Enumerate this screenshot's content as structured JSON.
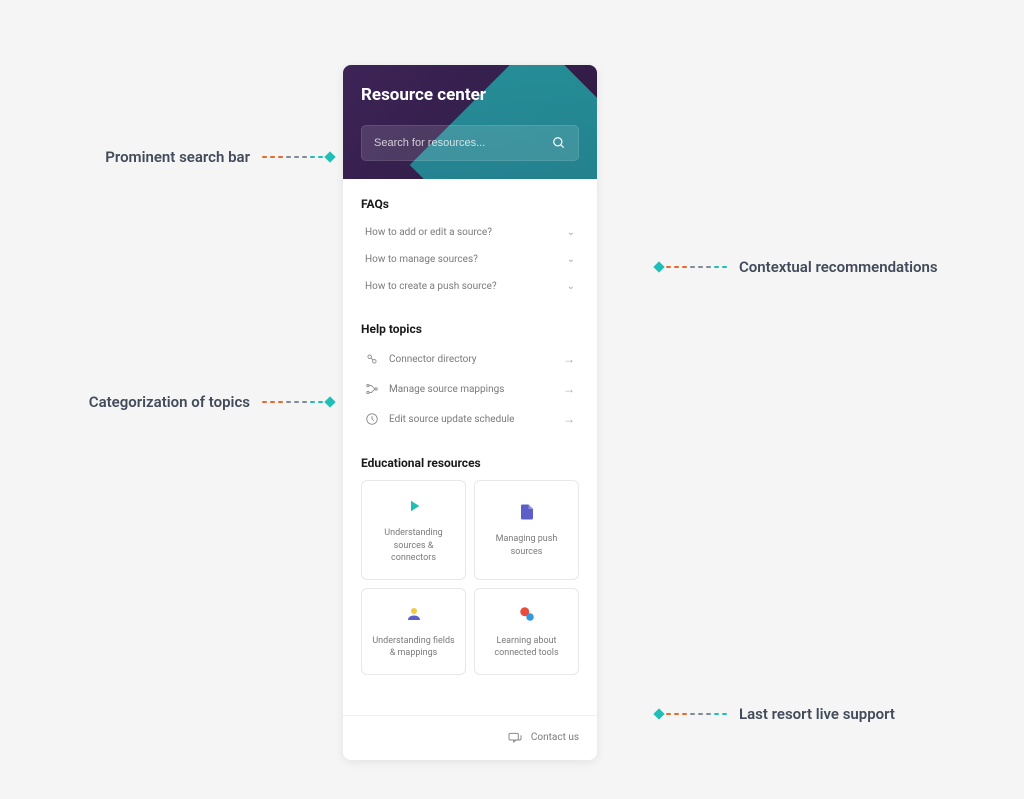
{
  "panel": {
    "title": "Resource center",
    "search_placeholder": "Search for resources..."
  },
  "faqs": {
    "title": "FAQs",
    "items": [
      "How to add or edit a source?",
      "How to manage sources?",
      "How to create a push source?"
    ]
  },
  "help_topics": {
    "title": "Help topics",
    "items": [
      "Connector directory",
      "Manage source mappings",
      "Edit source update schedule"
    ]
  },
  "educational": {
    "title": "Educational resources",
    "cards": [
      "Understanding sources & connectors",
      "Managing push sources",
      "Understanding fields & mappings",
      "Learning about connected tools"
    ]
  },
  "footer": {
    "contact": "Contact us"
  },
  "annotations": {
    "search": "Prominent search bar",
    "recommendations": "Contextual recommendations",
    "categorization": "Categorization of topics",
    "live_support": "Last resort live support"
  }
}
